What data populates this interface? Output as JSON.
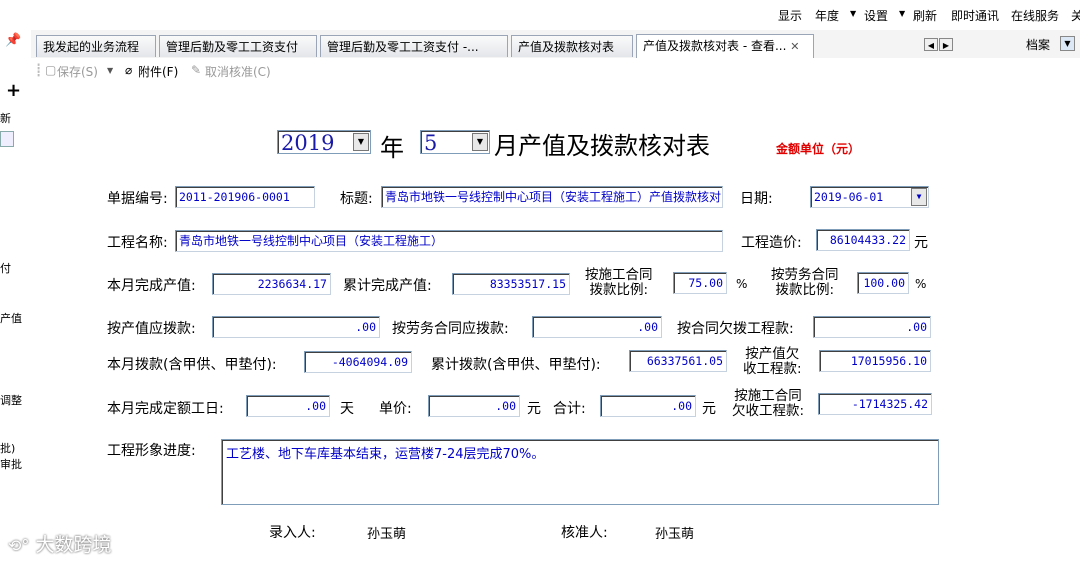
{
  "topbar": {
    "items": [
      "显示",
      "年度",
      "设置",
      "刷新",
      "即时通讯",
      "在线服务",
      "关"
    ]
  },
  "left_strip": {
    "pin": "📌",
    "plus": "+",
    "labels": [
      "新",
      "付",
      "产值",
      "调整",
      "批)",
      "审批"
    ]
  },
  "tabs": [
    {
      "label": "我发起的业务流程"
    },
    {
      "label": "管理后勤及零工工资支付"
    },
    {
      "label": "管理后勤及零工工资支付  -..."
    },
    {
      "label": "产值及拨款核对表"
    },
    {
      "label": "产值及拨款核对表  - 查看..."
    }
  ],
  "archive_label": "档案",
  "toolbar": {
    "save": "保存(S)",
    "attach": "附件(F)",
    "cancel_approve": "取消核准(C)"
  },
  "form": {
    "year": "2019",
    "year_suffix": "年",
    "month": "5",
    "title_suffix": "月产值及拨款核对表",
    "unit_note": "金额单位（元）",
    "doc_no_label": "单据编号:",
    "doc_no": "2011-201906-0001",
    "subject_label": "标题:",
    "subject": "青岛市地铁一号线控制中心项目（安装工程施工）产值拨款核对",
    "date_label": "日期:",
    "date": "2019-06-01",
    "project_label": "工程名称:",
    "project": "青岛市地铁一号线控制中心项目（安装工程施工）",
    "cost_label": "工程造价:",
    "cost": "86104433.22",
    "cost_unit": "元",
    "month_output_label": "本月完成产值:",
    "month_output": "2236634.17",
    "cum_output_label": "累计完成产值:",
    "cum_output": "83353517.15",
    "contract_ratio_label": [
      "按施工合同",
      "拨款比例:"
    ],
    "contract_ratio": "75.00",
    "pct1": "%",
    "labor_ratio_label": [
      "按劳务合同",
      "拨款比例:"
    ],
    "labor_ratio": "100.00",
    "pct2": "%",
    "by_output_label": "按产值应拨款:",
    "by_output": ".00",
    "by_labor_label": "按劳务合同应拨款:",
    "by_labor": ".00",
    "owed_contract_label": "按合同欠拨工程款:",
    "owed_contract": ".00",
    "month_pay_label": "本月拨款(含甲供、甲垫付):",
    "month_pay": "-4064094.09",
    "cum_pay_label": "累计拨款(含甲供、甲垫付):",
    "cum_pay": "66337561.05",
    "owed_output_label": [
      "按产值欠",
      "收工程款:"
    ],
    "owed_output": "17015956.10",
    "workdays_label": "本月完成定额工日:",
    "workdays": ".00",
    "day_unit": "天",
    "price_label": "单价:",
    "price": ".00",
    "yuan1": "元",
    "total_label": "合计:",
    "total": ".00",
    "yuan2": "元",
    "owed_construction_label": [
      "按施工合同",
      "欠收工程款:"
    ],
    "owed_construction": "-1714325.42",
    "progress_label": "工程形象进度:",
    "progress": "工艺楼、地下车库基本结束，运营楼7-24层完成70%。",
    "entered_by_label": "录入人:",
    "entered_by": "孙玉萌",
    "approved_by_label": "核准人:",
    "approved_by": "孙玉萌"
  },
  "watermark": "大数跨境"
}
